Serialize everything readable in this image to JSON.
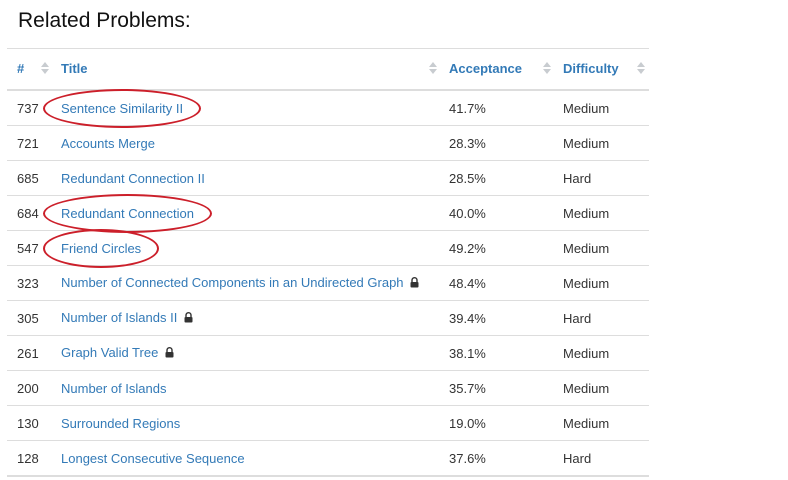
{
  "heading": "Related Problems:",
  "columns": {
    "num": "#",
    "title": "Title",
    "acceptance": "Acceptance",
    "difficulty": "Difficulty"
  },
  "problems": [
    {
      "num": "737",
      "title": "Sentence Similarity II",
      "acceptance": "41.7%",
      "difficulty": "Medium",
      "locked": false,
      "circled": true
    },
    {
      "num": "721",
      "title": "Accounts Merge",
      "acceptance": "28.3%",
      "difficulty": "Medium",
      "locked": false,
      "circled": false
    },
    {
      "num": "685",
      "title": "Redundant Connection II",
      "acceptance": "28.5%",
      "difficulty": "Hard",
      "locked": false,
      "circled": false
    },
    {
      "num": "684",
      "title": "Redundant Connection",
      "acceptance": "40.0%",
      "difficulty": "Medium",
      "locked": false,
      "circled": true
    },
    {
      "num": "547",
      "title": "Friend Circles",
      "acceptance": "49.2%",
      "difficulty": "Medium",
      "locked": false,
      "circled": true
    },
    {
      "num": "323",
      "title": "Number of Connected Components in an Undirected Graph",
      "acceptance": "48.4%",
      "difficulty": "Medium",
      "locked": true,
      "circled": false
    },
    {
      "num": "305",
      "title": "Number of Islands II",
      "acceptance": "39.4%",
      "difficulty": "Hard",
      "locked": true,
      "circled": false
    },
    {
      "num": "261",
      "title": "Graph Valid Tree",
      "acceptance": "38.1%",
      "difficulty": "Medium",
      "locked": true,
      "circled": false
    },
    {
      "num": "200",
      "title": "Number of Islands",
      "acceptance": "35.7%",
      "difficulty": "Medium",
      "locked": false,
      "circled": false
    },
    {
      "num": "130",
      "title": "Surrounded Regions",
      "acceptance": "19.0%",
      "difficulty": "Medium",
      "locked": false,
      "circled": false
    },
    {
      "num": "128",
      "title": "Longest Consecutive Sequence",
      "acceptance": "37.6%",
      "difficulty": "Hard",
      "locked": false,
      "circled": false
    }
  ],
  "icons": {
    "sort": "sort-icon",
    "lock": "lock-icon",
    "annotation": "red-ellipse-annotation"
  },
  "colors": {
    "link": "#337ab7",
    "annotation": "#cc1f2a",
    "border": "#dddddd"
  }
}
